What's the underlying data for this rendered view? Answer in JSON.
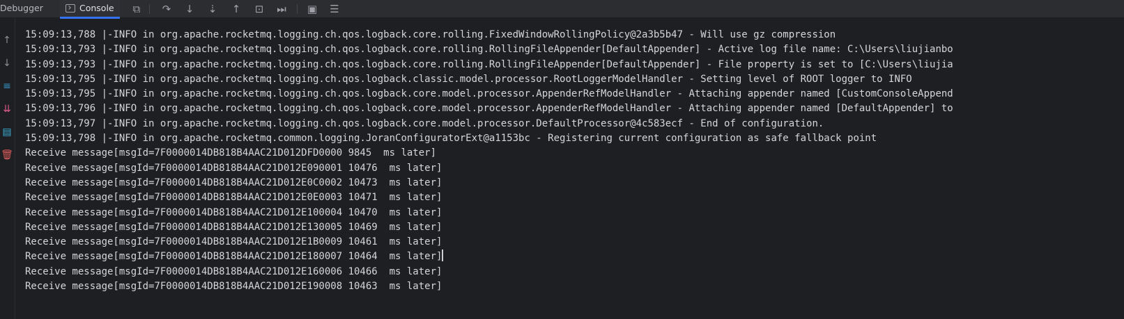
{
  "toolbar": {
    "tabs": [
      {
        "label": "Debugger"
      },
      {
        "label": "Console",
        "selected": true
      }
    ],
    "buttons": [
      {
        "name": "layout-icon",
        "glyph": "⧉"
      },
      {
        "name": "step-over-icon",
        "glyph": "↷"
      },
      {
        "name": "step-into-icon",
        "glyph": "↓"
      },
      {
        "name": "force-step-into-icon",
        "glyph": "⇣"
      },
      {
        "name": "step-out-icon",
        "glyph": "↑"
      },
      {
        "name": "run-to-cursor-icon",
        "glyph": "⊡"
      },
      {
        "name": "evaluate-icon",
        "glyph": "⏭"
      },
      {
        "name": "terminal-icon",
        "glyph": "▣"
      },
      {
        "name": "threads-icon",
        "glyph": "☰"
      }
    ]
  },
  "gutter": {
    "icons": [
      {
        "name": "scroll-up-icon",
        "glyph": "↑",
        "color": "#8c8f96"
      },
      {
        "name": "scroll-down-icon",
        "glyph": "↓",
        "color": "#8c8f96"
      },
      {
        "name": "soft-wrap-icon",
        "glyph": "≡",
        "color": "#3592c4"
      },
      {
        "name": "scroll-to-end-icon",
        "glyph": "⇊",
        "color": "#e0598b"
      },
      {
        "name": "print-icon",
        "glyph": "▤",
        "color": "#3ab0d6"
      },
      {
        "name": "clear-all-icon",
        "glyph": "🗑",
        "color": "#db5c5c"
      }
    ]
  },
  "console": {
    "lines": [
      "15:09:13,788 |-INFO in org.apache.rocketmq.logging.ch.qos.logback.core.rolling.FixedWindowRollingPolicy@2a3b5b47 - Will use gz compression",
      "15:09:13,793 |-INFO in org.apache.rocketmq.logging.ch.qos.logback.core.rolling.RollingFileAppender[DefaultAppender] - Active log file name: C:\\Users\\liujianbo",
      "15:09:13,793 |-INFO in org.apache.rocketmq.logging.ch.qos.logback.core.rolling.RollingFileAppender[DefaultAppender] - File property is set to [C:\\Users\\liujia",
      "15:09:13,795 |-INFO in org.apache.rocketmq.logging.ch.qos.logback.classic.model.processor.RootLoggerModelHandler - Setting level of ROOT logger to INFO",
      "15:09:13,795 |-INFO in org.apache.rocketmq.logging.ch.qos.logback.core.model.processor.AppenderRefModelHandler - Attaching appender named [CustomConsoleAppend",
      "15:09:13,796 |-INFO in org.apache.rocketmq.logging.ch.qos.logback.core.model.processor.AppenderRefModelHandler - Attaching appender named [DefaultAppender] to",
      "15:09:13,797 |-INFO in org.apache.rocketmq.logging.ch.qos.logback.core.model.processor.DefaultProcessor@4c583ecf - End of configuration.",
      "15:09:13,798 |-INFO in org.apache.rocketmq.common.logging.JoranConfiguratorExt@a1153bc - Registering current configuration as safe fallback point",
      "Receive message[msgId=7F0000014DB818B4AAC21D012DFD0000 9845  ms later]",
      "Receive message[msgId=7F0000014DB818B4AAC21D012E090001 10476  ms later]",
      "Receive message[msgId=7F0000014DB818B4AAC21D012E0C0002 10473  ms later]",
      "Receive message[msgId=7F0000014DB818B4AAC21D012E0E0003 10471  ms later]",
      "Receive message[msgId=7F0000014DB818B4AAC21D012E100004 10470  ms later]",
      "Receive message[msgId=7F0000014DB818B4AAC21D012E130005 10469  ms later]",
      "Receive message[msgId=7F0000014DB818B4AAC21D012E1B0009 10461  ms later]",
      "Receive message[msgId=7F0000014DB818B4AAC21D012E180007 10464  ms later]",
      "Receive message[msgId=7F0000014DB818B4AAC21D012E160006 10466  ms later]",
      "Receive message[msgId=7F0000014DB818B4AAC21D012E190008 10463  ms later]"
    ],
    "caret_line_index": 15
  }
}
